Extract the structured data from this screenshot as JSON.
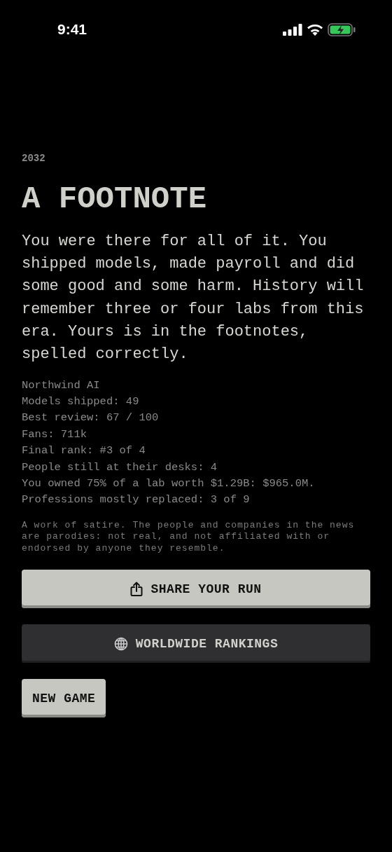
{
  "status_bar": {
    "time": "9:41"
  },
  "year": "2032",
  "title": "A FOOTNOTE",
  "summary": "You were there for all of it. You shipped models, made payroll and did some good and some harm. History will remember three or four labs from this era. Yours is in the footnotes, spelled correctly.",
  "stats": [
    "Northwind AI",
    "Models shipped: 49",
    "Best review: 67 / 100",
    "Fans: 711k",
    "Final rank: #3 of 4",
    "People still at their desks: 4",
    "You owned 75% of a lab worth $1.29B: $965.0M.",
    "Professions mostly replaced: 3 of 9"
  ],
  "disclaimer": "A work of satire. The people and companies in the news are parodies: not real, and not affiliated with or endorsed by anyone they resemble.",
  "buttons": [
    {
      "label": "SHARE YOUR RUN",
      "kind": "share"
    },
    {
      "label": "WORLDWIDE RANKINGS",
      "kind": "rankings"
    },
    {
      "label": "NEW GAME",
      "kind": "new"
    }
  ]
}
